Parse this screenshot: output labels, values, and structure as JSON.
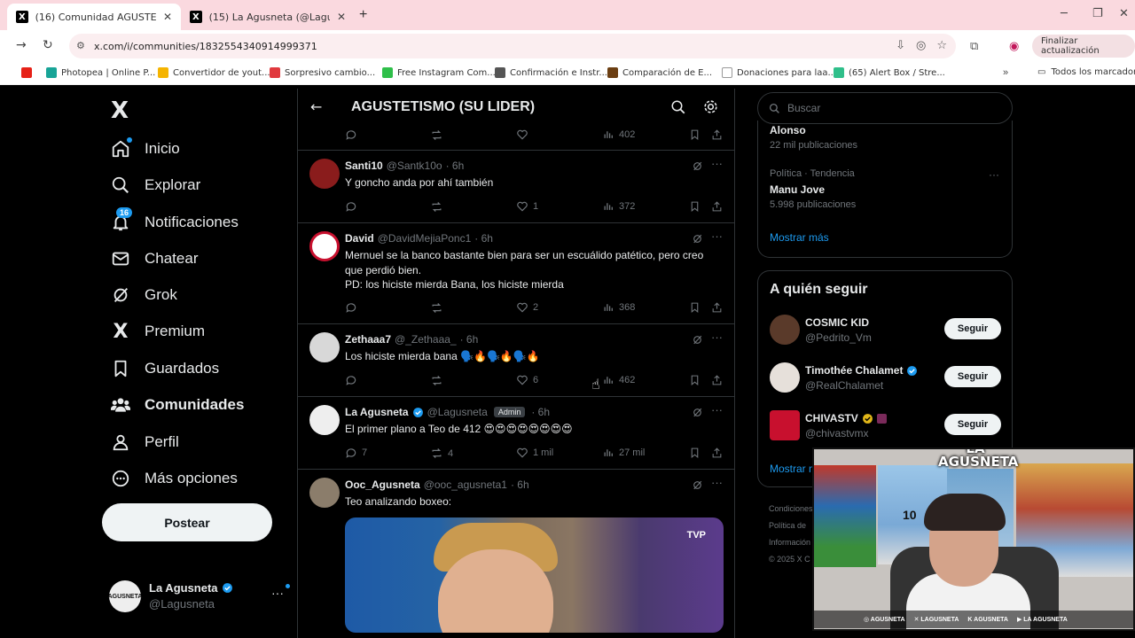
{
  "browser": {
    "tabs": [
      {
        "title": "(16) Comunidad AGUSTETISMO",
        "close": "✕"
      },
      {
        "title": "(15) La Agusneta (@Lagusneta)",
        "close": "✕"
      }
    ],
    "new_tab": "+",
    "url": "x.com/i/communities/1832554340914999371",
    "update_label": "Finalizar actualización",
    "bookmarks": [
      {
        "label": "Photopea | Online P...",
        "color": "#18a497"
      },
      {
        "label": "Convertidor de yout...",
        "color": "#f5b400"
      },
      {
        "label": "Sorpresivo cambio...",
        "color": "#e0393e"
      },
      {
        "label": "Free Instagram Com...",
        "color": "#2fbf4a"
      },
      {
        "label": "Confirmación e Instr...",
        "color": "#555555"
      },
      {
        "label": "Comparación de E...",
        "color": "#6b3e12"
      },
      {
        "label": "Donaciones para laa...",
        "color": "#555555"
      },
      {
        "label": "(65) Alert Box / Stre...",
        "color": "#2fbf8a"
      }
    ],
    "all_bookmarks": "Todos los marcadores"
  },
  "nav": {
    "brand": "X",
    "notif_count": "16",
    "items": [
      {
        "label": "Inicio",
        "icon": "home-icon"
      },
      {
        "label": "Explorar",
        "icon": "search-icon"
      },
      {
        "label": "Notificaciones",
        "icon": "bell-icon"
      },
      {
        "label": "Chatear",
        "icon": "mail-icon"
      },
      {
        "label": "Grok",
        "icon": "grok-icon"
      },
      {
        "label": "Premium",
        "icon": "x-premium-icon"
      },
      {
        "label": "Guardados",
        "icon": "bookmark-icon"
      },
      {
        "label": "Comunidades",
        "icon": "communities-icon"
      },
      {
        "label": "Perfil",
        "icon": "person-icon"
      },
      {
        "label": "Más opciones",
        "icon": "more-circle-icon"
      }
    ],
    "post_label": "Postear",
    "account": {
      "name": "La Agusneta",
      "handle": "@Lagusneta",
      "avatar_text": "AGUSNETA",
      "more": "···"
    }
  },
  "timeline": {
    "title": "AGUSTETISMO (SU LIDER)",
    "top_views": "402",
    "tweets": [
      {
        "name": "Santi10",
        "handle": "@Santk10o",
        "time": "· 6h",
        "text": "Y goncho anda por ahí también",
        "replies": "",
        "retweets": "",
        "likes": "1",
        "views": "372",
        "avatar_color": "#8a1c1c"
      },
      {
        "name": "David",
        "handle": "@DavidMejiaPonc1",
        "time": "· 6h",
        "text": "Mernuel se la banco bastante bien para ser un escuálido patético, pero creo que perdió bien.\nPD: los hiciste mierda Bana, los hiciste mierda",
        "replies": "",
        "retweets": "",
        "likes": "2",
        "views": "368",
        "avatar_color": "#ffffff"
      },
      {
        "name": "Zethaaa7",
        "handle": "@_Zethaaa_",
        "time": "· 6h",
        "text": "Los hiciste mierda bana 🗣️🔥🗣️🔥🗣️🔥",
        "replies": "",
        "retweets": "",
        "likes": "6",
        "views": "462",
        "avatar_color": "#d8d8d8"
      },
      {
        "name": "La Agusneta",
        "handle": "@Lagusneta",
        "admin": "Admin",
        "time": "· 6h",
        "text": "El primer plano a Teo de 412 😍😍😍😍😍😍😍😍",
        "replies": "7",
        "retweets": "4",
        "likes": "1 mil",
        "views": "27 mil",
        "avatar_color": "#eeeeee"
      },
      {
        "name": "Ooc_Agusneta",
        "handle": "@ooc_agusneta1",
        "time": "· 6h",
        "text": "Teo analizando boxeo:",
        "avatar_color": "#8b7d6b",
        "media_badge": "TVP"
      }
    ]
  },
  "right": {
    "search_placeholder": "Buscar",
    "trends": [
      {
        "name": "Alonso",
        "meta": "22 mil publicaciones"
      },
      {
        "category": "Política · Tendencia",
        "name": "Manu Jove",
        "meta": "5.998 publicaciones"
      }
    ],
    "trends_more": "···",
    "show_more": "Mostrar más",
    "who_to_follow_title": "A quién seguir",
    "who_to_follow": [
      {
        "name": "COSMIC KID",
        "handle": "@Pedrito_Vm",
        "avatar_color": "#5a3a2a",
        "verified": false
      },
      {
        "name": "Timothée Chalamet",
        "handle": "@RealChalamet",
        "avatar_color": "#e6e0da",
        "verified": true
      },
      {
        "name": "CHIVASTV",
        "handle": "@chivastvmx",
        "avatar_color": "#c8102e",
        "verified": true
      }
    ],
    "follow_label": "Seguir",
    "who_show_more": "Mostrar más",
    "footer": [
      "Condiciones",
      "Política de",
      "Información",
      "© 2025 X C"
    ]
  },
  "webcam": {
    "logo": "LA AGUSNETA",
    "jersey_number": "10",
    "socials": [
      "AGUSNETA",
      "LAGUSNETA",
      "AGUSNETA",
      "LA AGUSNETA"
    ]
  },
  "colors": {
    "accent": "#1d9bf0",
    "bg": "#000000",
    "border": "#2f3336",
    "muted": "#71767b",
    "text": "#e7e9ea"
  }
}
